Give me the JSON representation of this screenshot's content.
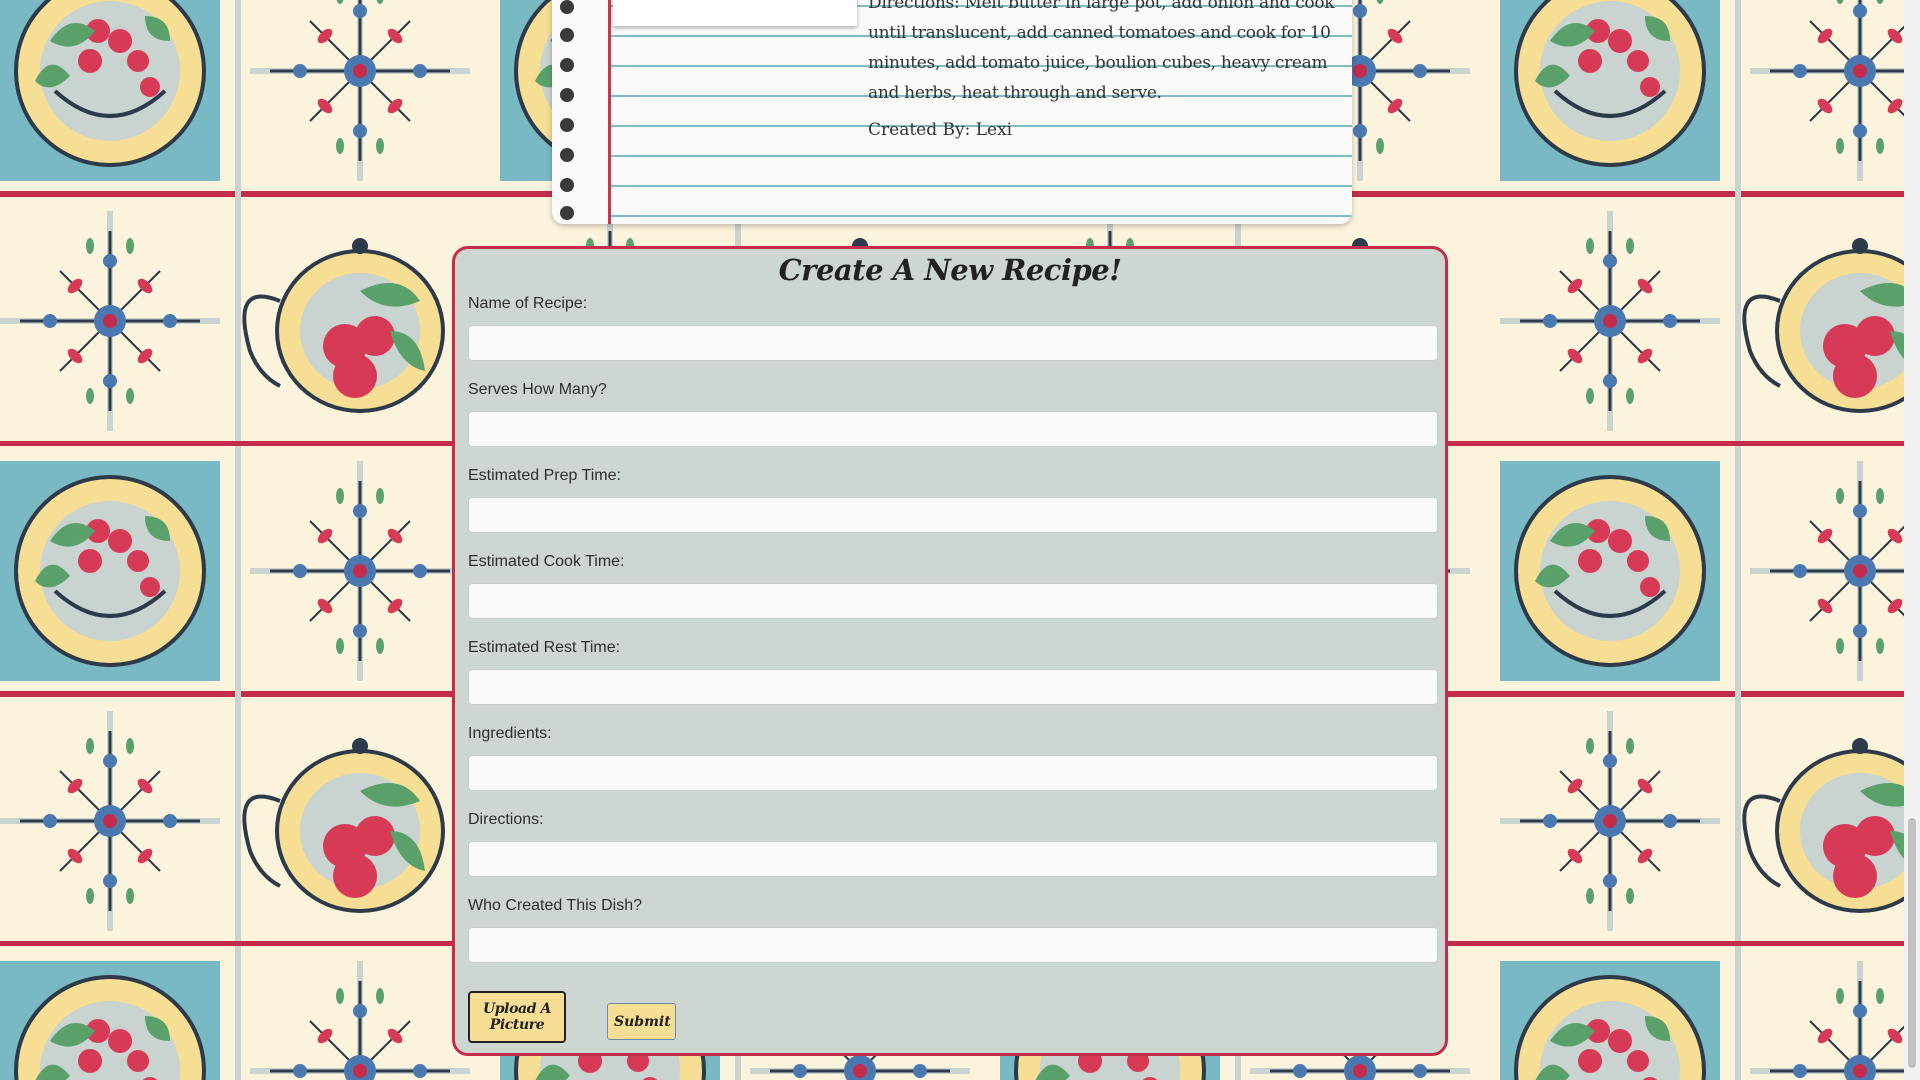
{
  "notebook": {
    "directions": "Directions: Melt butter in large pot, add onion and cook until translucent, add canned tomatoes and cook for 10 minutes, add tomato juice, boulion cubes, heavy cream and herbs, heat through and serve.",
    "creator": "Created By: Lexi"
  },
  "form": {
    "title": "Create A New Recipe!",
    "fields": [
      {
        "label": "Name of Recipe:",
        "value": ""
      },
      {
        "label": "Serves How Many?",
        "value": ""
      },
      {
        "label": "Estimated Prep Time:",
        "value": ""
      },
      {
        "label": "Estimated Cook Time:",
        "value": ""
      },
      {
        "label": "Estimated Rest Time:",
        "value": ""
      },
      {
        "label": "Ingredients:",
        "value": ""
      },
      {
        "label": "Directions:",
        "value": ""
      },
      {
        "label": "Who Created This Dish?",
        "value": ""
      }
    ],
    "upload_label": "Upload A Picture",
    "submit_label": "Submit"
  },
  "colors": {
    "panel_bg": "#cdd6d0",
    "panel_border": "#c42c4c",
    "button_bg": "#f6de94",
    "wallpaper_cream": "#fbf3dc",
    "wallpaper_teal": "#78b9c4",
    "wallpaper_red": "#c42c4c",
    "wallpaper_yellow": "#f6de94"
  }
}
